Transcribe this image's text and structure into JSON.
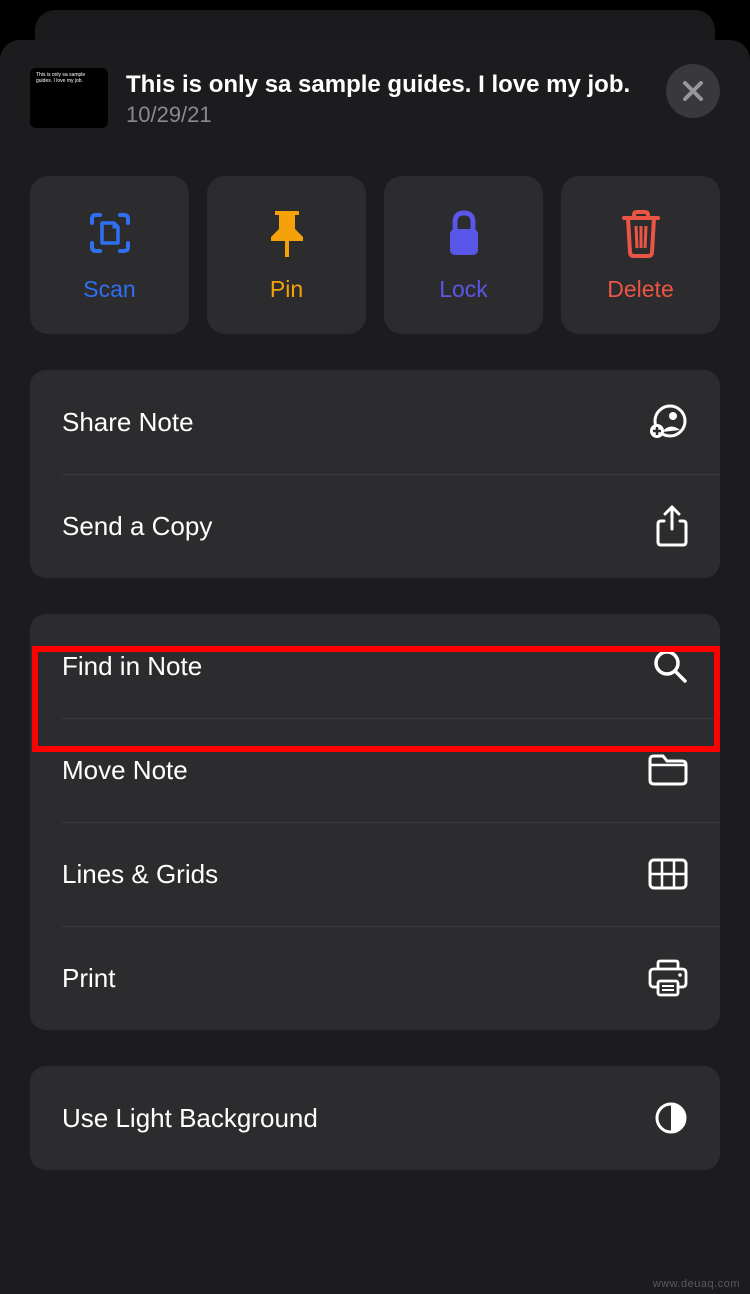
{
  "header": {
    "note_title": "This is only sa sample guides. I love my job.",
    "note_date": "10/29/21",
    "thumb_text": "This is only sa sample guides. I love my job."
  },
  "quick_actions": {
    "scan": "Scan",
    "pin": "Pin",
    "lock": "Lock",
    "delete": "Delete"
  },
  "menu": {
    "share_note": "Share Note",
    "send_copy": "Send a Copy",
    "find_in_note": "Find in Note",
    "move_note": "Move Note",
    "lines_grids": "Lines & Grids",
    "print": "Print",
    "light_bg": "Use Light Background"
  },
  "watermark": "www.deuaq.com"
}
